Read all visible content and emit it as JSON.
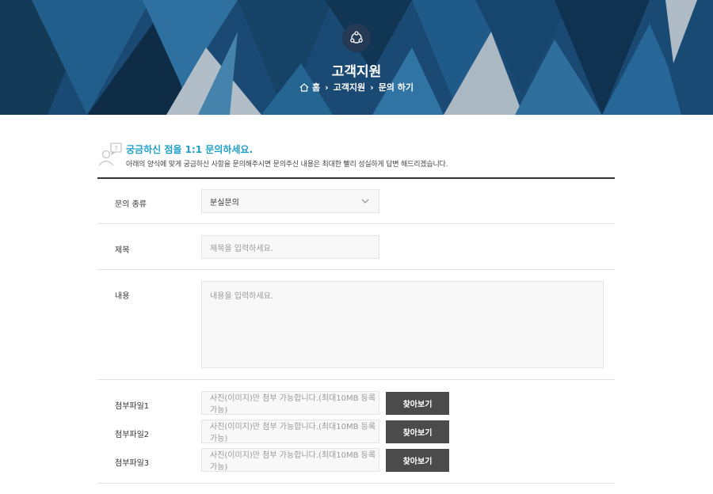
{
  "hero": {
    "title": "고객지원",
    "breadcrumb": [
      "홈",
      "고객지원",
      "문의 하기"
    ]
  },
  "intro": {
    "heading": "궁금하신 점을 1:1 문의하세요.",
    "description": "아래의 양식에 맞게 궁금하신 사항을 문의해주시면 문의주신 내용은 최대한 빨리 성실하게 답변 해드리겠습니다."
  },
  "form": {
    "category": {
      "label": "문의 종류",
      "value": "분실문의"
    },
    "title": {
      "label": "제목",
      "placeholder": "제목을 입력하세요."
    },
    "content": {
      "label": "내용",
      "placeholder": "내용을 입력하세요."
    },
    "attachments": [
      {
        "label": "첨부파일1",
        "placeholder": "사진(이미지)만 첨부 가능합니다.(최대10MB 등록 가능)",
        "button": "찾아보기"
      },
      {
        "label": "첨부파일2",
        "placeholder": "사진(이미지)만 첨부 가능합니다.(최대10MB 등록 가능)",
        "button": "찾아보기"
      },
      {
        "label": "첨부파일3",
        "placeholder": "사진(이미지)만 첨부 가능합니다.(최대10MB 등록 가능)",
        "button": "찾아보기"
      }
    ]
  },
  "icons": {
    "hero": "share-nodes-icon",
    "home": "home-icon",
    "breadcrumb_separator": "chevron-right-icon",
    "intro": "person-question-icon",
    "select": "chevron-down-icon"
  },
  "colors": {
    "hero_bg": "#1d4f7a",
    "accent": "#1e9fc9",
    "button": "#4b4b4b",
    "field_bg": "#f8f8f8"
  }
}
